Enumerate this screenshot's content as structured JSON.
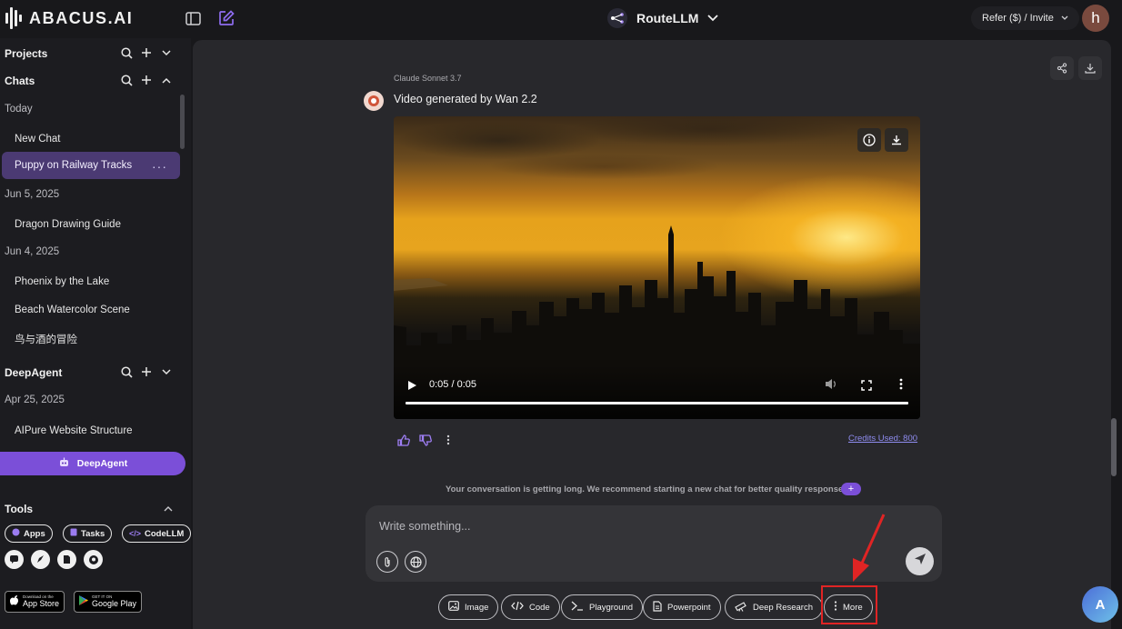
{
  "brand": {
    "name": "ABACUS.AI"
  },
  "header": {
    "model_selector": "RouteLLM",
    "refer_label": "Refer ($) / Invite",
    "avatar_initial": "h"
  },
  "sidebar": {
    "projects_title": "Projects",
    "chats_title": "Chats",
    "groups": [
      {
        "date": "Today",
        "items": [
          "New Chat",
          "Puppy on Railway Tracks"
        ]
      },
      {
        "date": "Jun 5, 2025",
        "items": [
          "Dragon Drawing Guide"
        ]
      },
      {
        "date": "Jun 4, 2025",
        "items": [
          "Phoenix by the Lake",
          "Beach Watercolor Scene",
          "鸟与酒的冒险"
        ]
      }
    ],
    "active_chat": "Puppy on Railway Tracks",
    "deepagent_title": "DeepAgent",
    "deepagent_groups": [
      {
        "date": "Apr 25, 2025",
        "items": [
          "AIPure Website Structure"
        ]
      }
    ],
    "deepagent_button": "DeepAgent",
    "tools_title": "Tools",
    "tools": [
      "Apps",
      "Tasks",
      "CodeLLM"
    ],
    "app_store": {
      "small": "Download on the",
      "big": "App Store"
    },
    "google_play": {
      "small": "GET IT ON",
      "big": "Google Play"
    }
  },
  "message": {
    "model": "Claude Sonnet 3.7",
    "title": "Video generated by Wan 2.2",
    "video_time": "0:05 / 0:05",
    "video_progress": 1.0,
    "credits": "Credits Used: 800"
  },
  "notice": {
    "text": "Your conversation is getting long. We recommend starting a new chat for better quality responses.",
    "plus": "+"
  },
  "composer": {
    "placeholder": "Write something..."
  },
  "chips": [
    "Image",
    "Code",
    "Playground",
    "Powerpoint",
    "Deep Research",
    "More"
  ],
  "colors": {
    "accent": "#7b4fd8",
    "active_chat_bg": "#4b3a73",
    "highlight": "#e02424"
  }
}
